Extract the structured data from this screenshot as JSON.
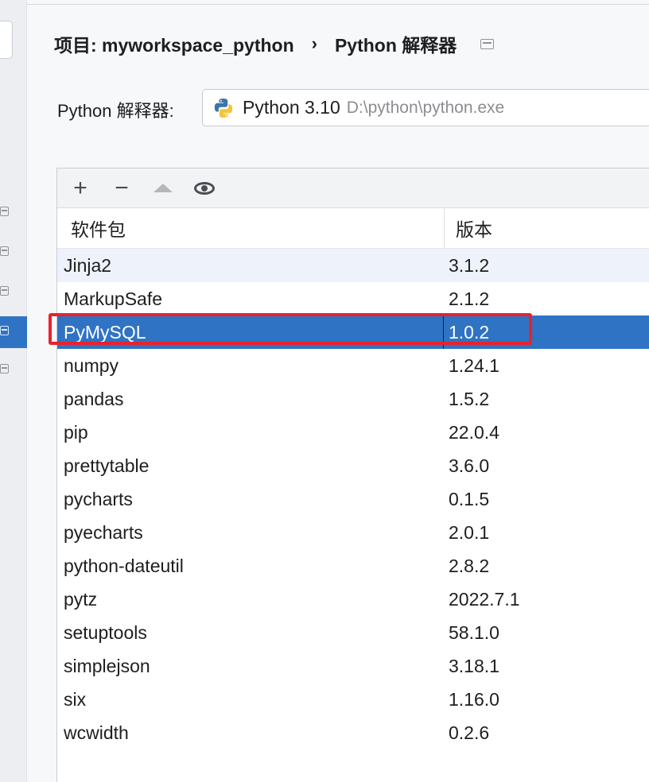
{
  "breadcrumb": {
    "project": "项目: myworkspace_python",
    "separator": "›",
    "page": "Python 解释器"
  },
  "interpreter": {
    "label": "Python 解释器:",
    "name": "Python 3.10",
    "path": "D:\\python\\python.exe"
  },
  "toolbar": {
    "add_icon": "+",
    "remove_icon": "−"
  },
  "table": {
    "headers": {
      "package": "软件包",
      "version": "版本"
    },
    "rows": [
      {
        "package": "Jinja2",
        "version": "3.1.2"
      },
      {
        "package": "MarkupSafe",
        "version": "2.1.2"
      },
      {
        "package": "PyMySQL",
        "version": "1.0.2"
      },
      {
        "package": "numpy",
        "version": "1.24.1"
      },
      {
        "package": "pandas",
        "version": "1.5.2"
      },
      {
        "package": "pip",
        "version": "22.0.4"
      },
      {
        "package": "prettytable",
        "version": "3.6.0"
      },
      {
        "package": "pycharts",
        "version": "0.1.5"
      },
      {
        "package": "pyecharts",
        "version": "2.0.1"
      },
      {
        "package": "python-dateutil",
        "version": "2.8.2"
      },
      {
        "package": "pytz",
        "version": "2022.7.1"
      },
      {
        "package": "setuptools",
        "version": "58.1.0"
      },
      {
        "package": "simplejson",
        "version": "3.18.1"
      },
      {
        "package": "six",
        "version": "1.16.0"
      },
      {
        "package": "wcwidth",
        "version": "0.2.6"
      }
    ],
    "selected_index": 2
  },
  "colors": {
    "selection": "#2f73c4",
    "highlight_box": "#e8222c"
  }
}
